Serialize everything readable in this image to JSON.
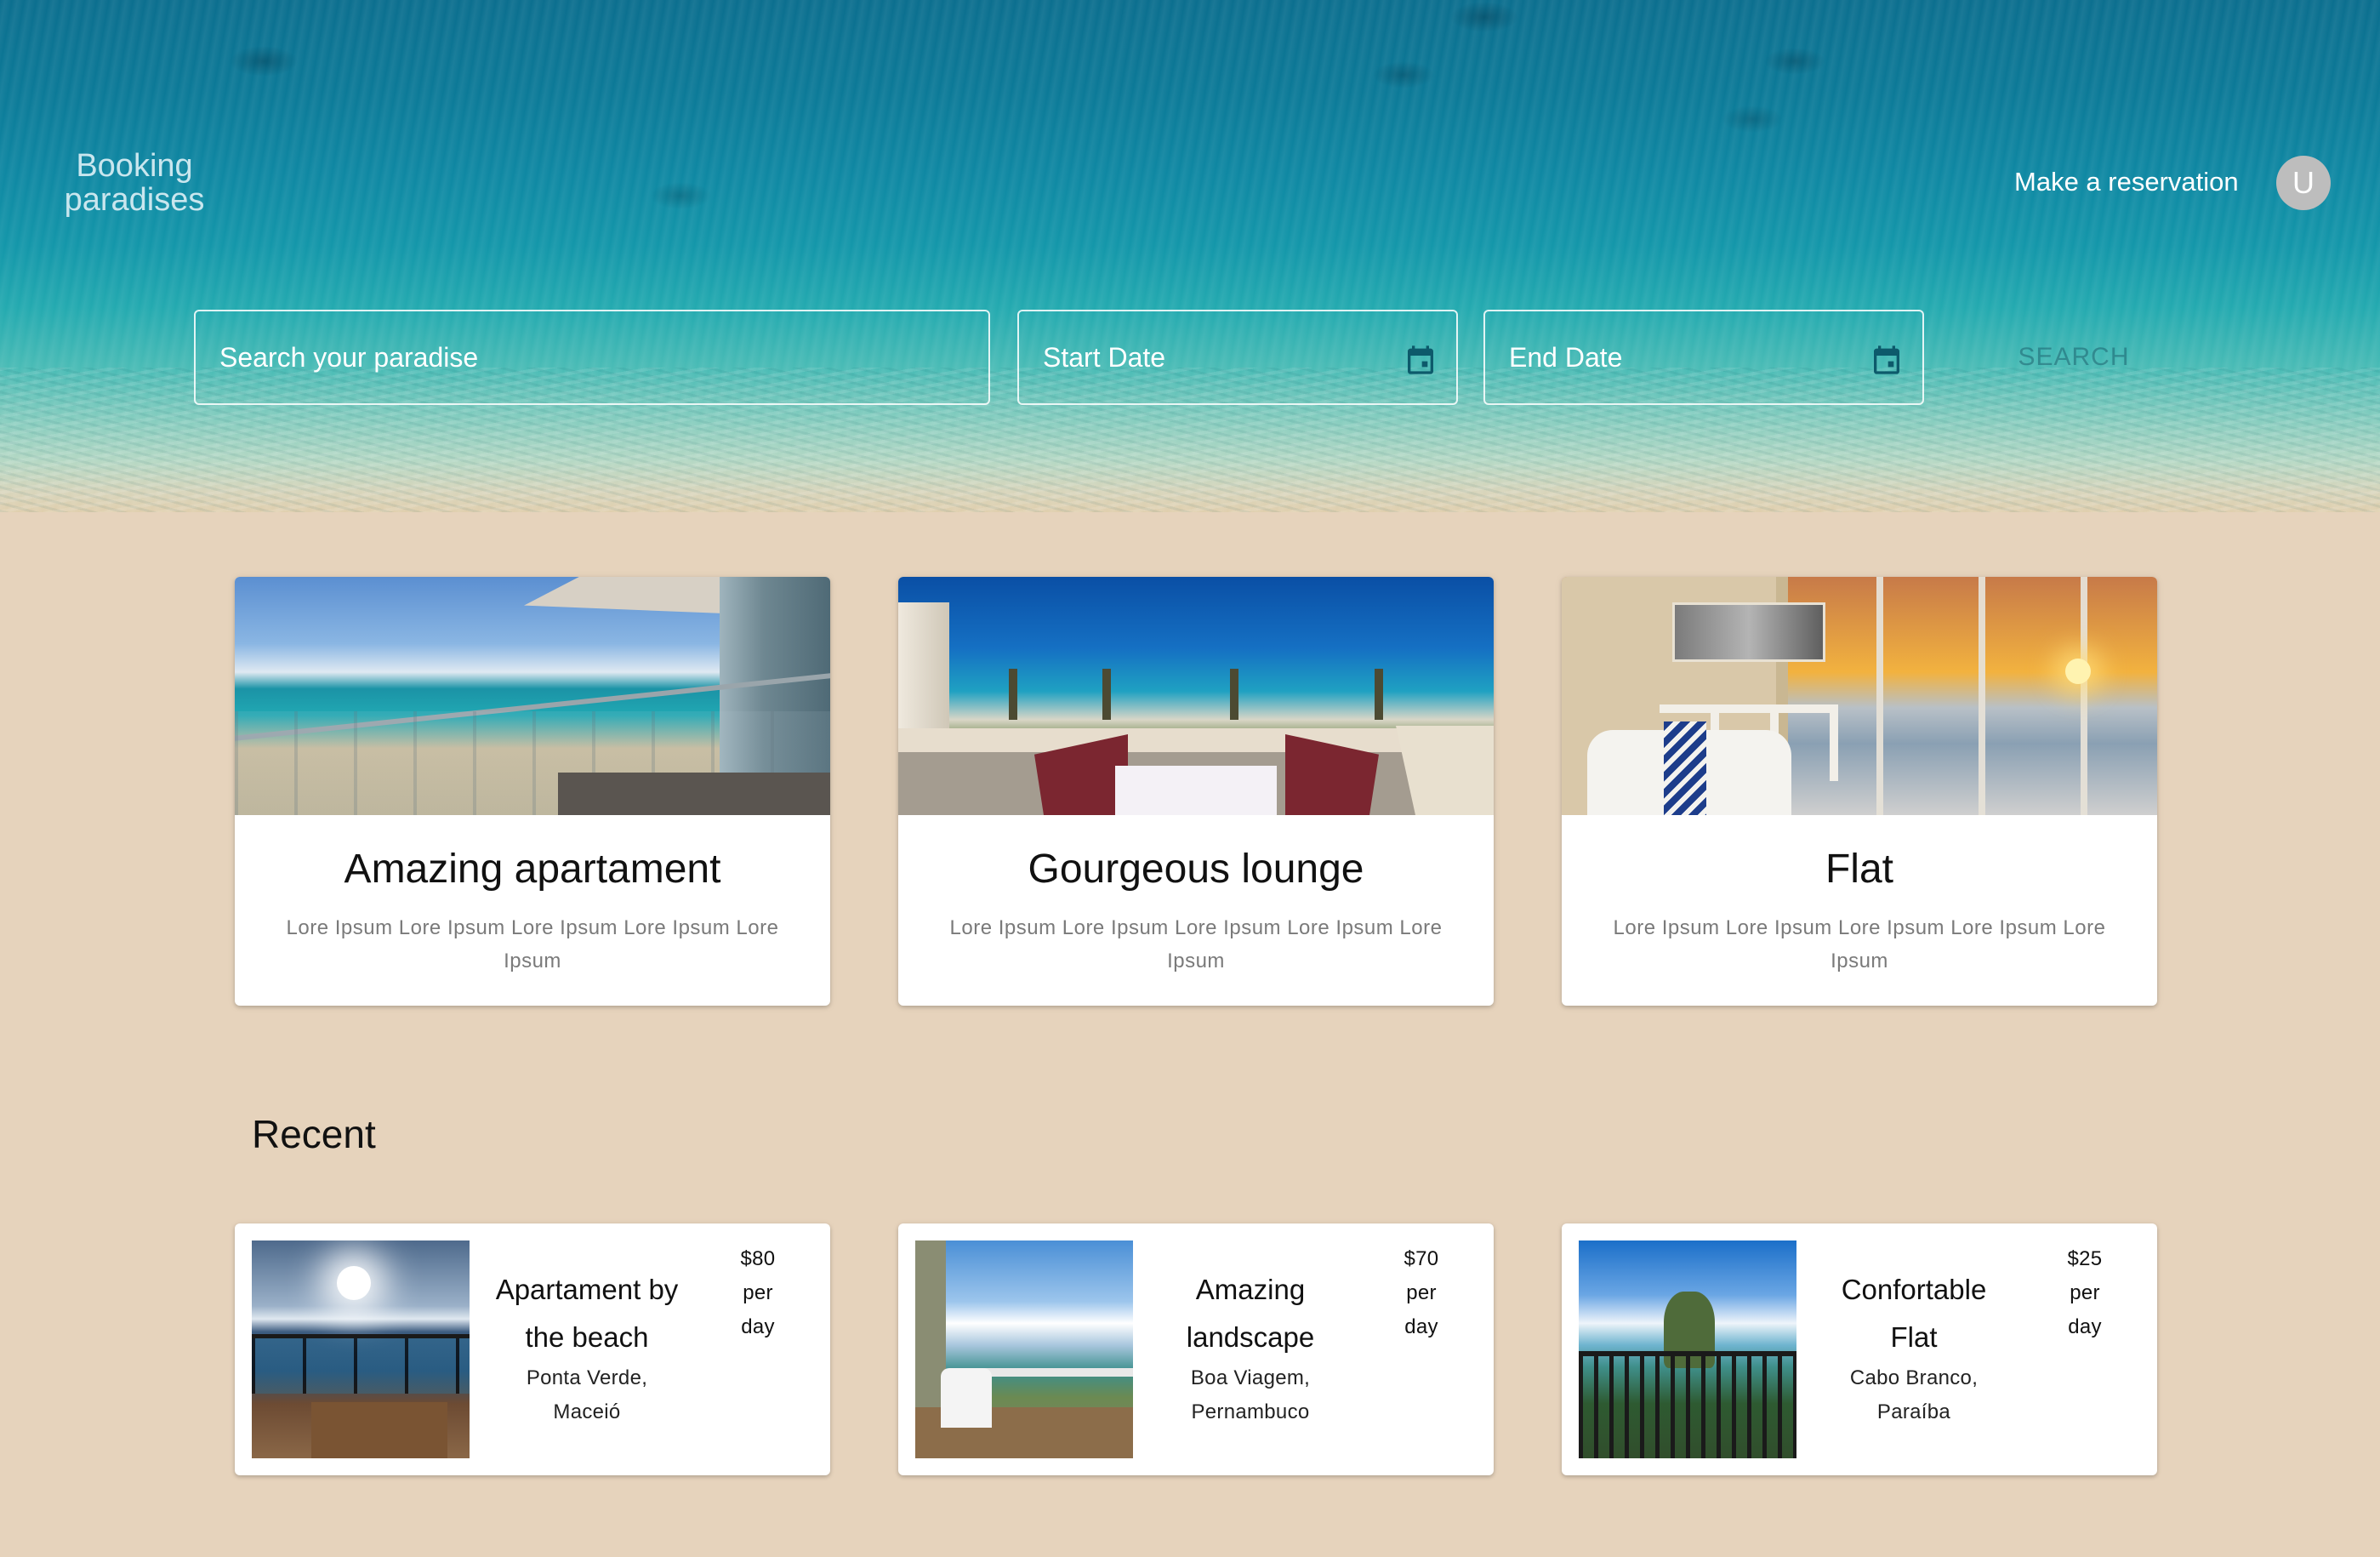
{
  "header": {
    "brand": "Booking paradises",
    "reserve_link": "Make a reservation",
    "avatar_initial": "U"
  },
  "search": {
    "query_placeholder": "Search your paradise",
    "start_placeholder": "Start Date",
    "end_placeholder": "End Date",
    "button_label": "SEARCH"
  },
  "featured": [
    {
      "title": "Amazing apartament",
      "description": "Lore Ipsum Lore Ipsum Lore Ipsum Lore Ipsum Lore Ipsum"
    },
    {
      "title": "Gourgeous lounge",
      "description": "Lore Ipsum Lore Ipsum Lore Ipsum Lore Ipsum Lore Ipsum"
    },
    {
      "title": "Flat",
      "description": "Lore Ipsum Lore Ipsum Lore Ipsum Lore Ipsum Lore Ipsum"
    }
  ],
  "recent": {
    "heading": "Recent",
    "items": [
      {
        "title": "Apartament by the beach",
        "location": "Ponta Verde, Maceió",
        "price": "$80",
        "per": "per",
        "unit": "day"
      },
      {
        "title": "Amazing landscape",
        "location": "Boa Viagem, Pernambuco",
        "price": "$70",
        "per": "per",
        "unit": "day"
      },
      {
        "title": "Confortable Flat",
        "location": "Cabo Branco, Paraíba",
        "price": "$25",
        "per": "per",
        "unit": "day"
      }
    ]
  },
  "colors": {
    "page_background": "#e6d3bc",
    "card_background": "#ffffff",
    "avatar": "#bdbdbd",
    "calendar_icon": "#0d5a6b"
  },
  "icons": [
    "calendar-icon"
  ]
}
